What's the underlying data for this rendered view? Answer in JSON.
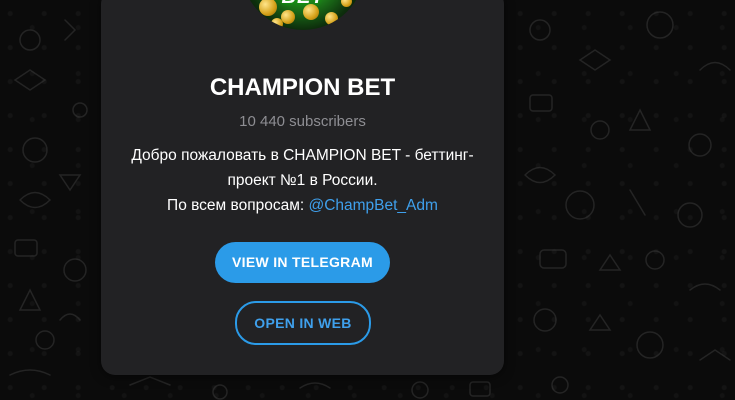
{
  "channel": {
    "avatar_text": "BET",
    "title": "CHAMPION BET",
    "subscribers": "10 440 subscribers",
    "description_line1": "Добро пожаловать в CHAMPION BET - беттинг-",
    "description_line2": "проект №1 в России.",
    "description_line3_prefix": "По всем вопросам: ",
    "description_link": "@ChampBet_Adm"
  },
  "actions": {
    "view_in_telegram": "VIEW IN TELEGRAM",
    "open_in_web": "OPEN IN WEB"
  },
  "colors": {
    "accent": "#2b9be8",
    "link": "#3fa0ec",
    "card_bg": "#222224",
    "page_bg": "#0b0b0b",
    "muted_text": "#8e8e93"
  }
}
